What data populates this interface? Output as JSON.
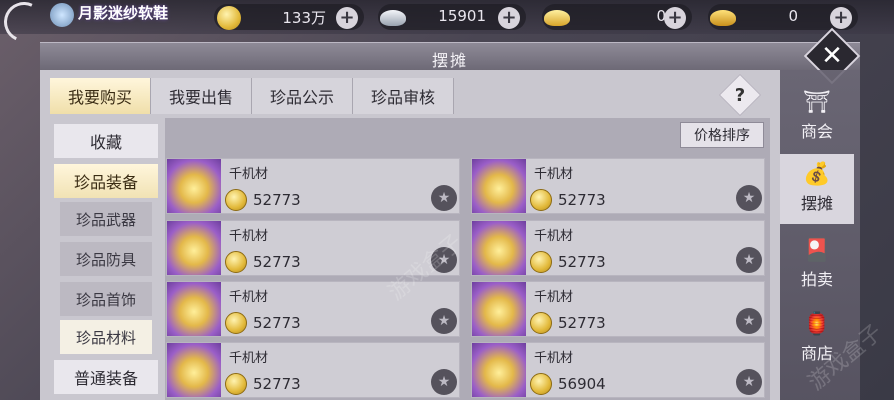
{
  "topbar": {
    "title": "月影迷纱软鞋",
    "currencies": [
      {
        "icon": "gold-coin-icon",
        "value": "133万"
      },
      {
        "icon": "silver-ingot-icon",
        "value": "15901"
      },
      {
        "icon": "gold-ingot-icon",
        "value": "0"
      },
      {
        "icon": "yuanbao-icon",
        "value": "0"
      }
    ]
  },
  "panel": {
    "title": "摆摊",
    "close": "✕",
    "help": "?"
  },
  "tabs": [
    "我要购买",
    "我要出售",
    "珍品公示",
    "珍品审核"
  ],
  "categories": {
    "favorites": "收藏",
    "rare_equipment": "珍品装备",
    "sub": [
      "珍品武器",
      "珍品防具",
      "珍品首饰",
      "珍品材料"
    ],
    "normal_equipment": "普通装备"
  },
  "sort_label": "价格排序",
  "listings": [
    {
      "name": "千机材",
      "price": "52773"
    },
    {
      "name": "千机材",
      "price": "52773"
    },
    {
      "name": "千机材",
      "price": "52773"
    },
    {
      "name": "千机材",
      "price": "52773"
    },
    {
      "name": "千机材",
      "price": "52773"
    },
    {
      "name": "千机材",
      "price": "52773"
    },
    {
      "name": "千机材",
      "price": "52773"
    },
    {
      "name": "千机材",
      "price": "56904"
    }
  ],
  "side_nav": [
    {
      "label": "商会",
      "icon": "guild-icon"
    },
    {
      "label": "摆摊",
      "icon": "stall-icon"
    },
    {
      "label": "拍卖",
      "icon": "auction-icon"
    },
    {
      "label": "商店",
      "icon": "shop-icon"
    }
  ],
  "watermark": "游戏盒子"
}
